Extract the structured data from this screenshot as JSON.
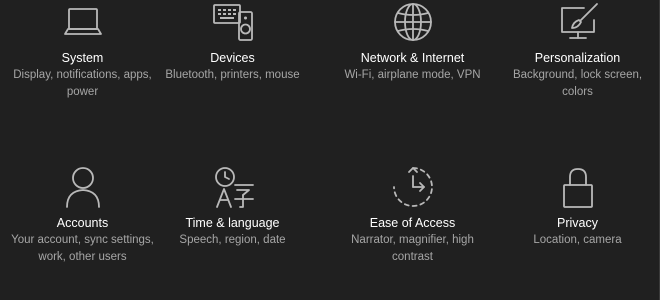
{
  "settings_tiles": [
    {
      "icon": "laptop-icon",
      "title": "System",
      "description": "Display, notifications, apps, power"
    },
    {
      "icon": "keyboard-speaker-icon",
      "title": "Devices",
      "description": "Bluetooth, printers, mouse"
    },
    {
      "icon": "globe-icon",
      "title": "Network & Internet",
      "description": "Wi-Fi, airplane mode, VPN"
    },
    {
      "icon": "paint-brush-monitor-icon",
      "title": "Personalization",
      "description": "Background, lock screen, colors"
    },
    {
      "icon": "person-icon",
      "title": "Accounts",
      "description": "Your account, sync settings, work, other users"
    },
    {
      "icon": "language-icon",
      "title": "Time & language",
      "description": "Speech, region, date"
    },
    {
      "icon": "ease-of-access-icon",
      "title": "Ease of Access",
      "description": "Narrator, magnifier, high contrast"
    },
    {
      "icon": "lock-icon",
      "title": "Privacy",
      "description": "Location, camera"
    }
  ],
  "colors": {
    "background": "#202020",
    "title_text": "#ffffff",
    "description_text": "#a6a6a6",
    "icon_stroke": "#b9b9b9"
  }
}
